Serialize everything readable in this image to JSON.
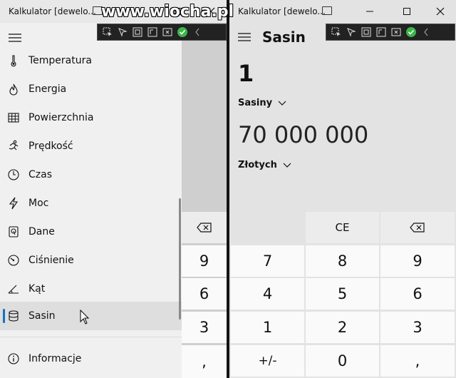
{
  "watermark": "www.wiocha.pl",
  "colors": {
    "accent": "#1570c4",
    "check": "#3cb54a"
  },
  "left_window": {
    "title": "Kalkulator [dewelo...",
    "menu": [
      {
        "label": "Temperatura",
        "icon": "thermometer-icon"
      },
      {
        "label": "Energia",
        "icon": "fire-icon"
      },
      {
        "label": "Powierzchnia",
        "icon": "grid-icon"
      },
      {
        "label": "Prędkość",
        "icon": "runner-icon"
      },
      {
        "label": "Czas",
        "icon": "clock-icon"
      },
      {
        "label": "Moc",
        "icon": "lightning-icon"
      },
      {
        "label": "Dane",
        "icon": "hard-drive-icon"
      },
      {
        "label": "Ciśnienie",
        "icon": "gauge-icon"
      },
      {
        "label": "Kąt",
        "icon": "angle-icon"
      },
      {
        "label": "Sasin",
        "icon": "database-icon",
        "selected": true
      }
    ],
    "info_label": "Informacje",
    "keys": [
      "9",
      "6",
      "3",
      ","
    ]
  },
  "right_window": {
    "title": "Kalkulator [dewelo...",
    "header": "Sasin",
    "input": {
      "value": "1",
      "unit": "Sasiny"
    },
    "output": {
      "value": "70 000 000",
      "unit": "Złotych"
    },
    "keypad": {
      "ce": "CE",
      "rows": [
        [
          "7",
          "8",
          "9"
        ],
        [
          "4",
          "5",
          "6"
        ],
        [
          "1",
          "2",
          "3"
        ],
        [
          "+/-",
          "0",
          ","
        ]
      ]
    }
  }
}
